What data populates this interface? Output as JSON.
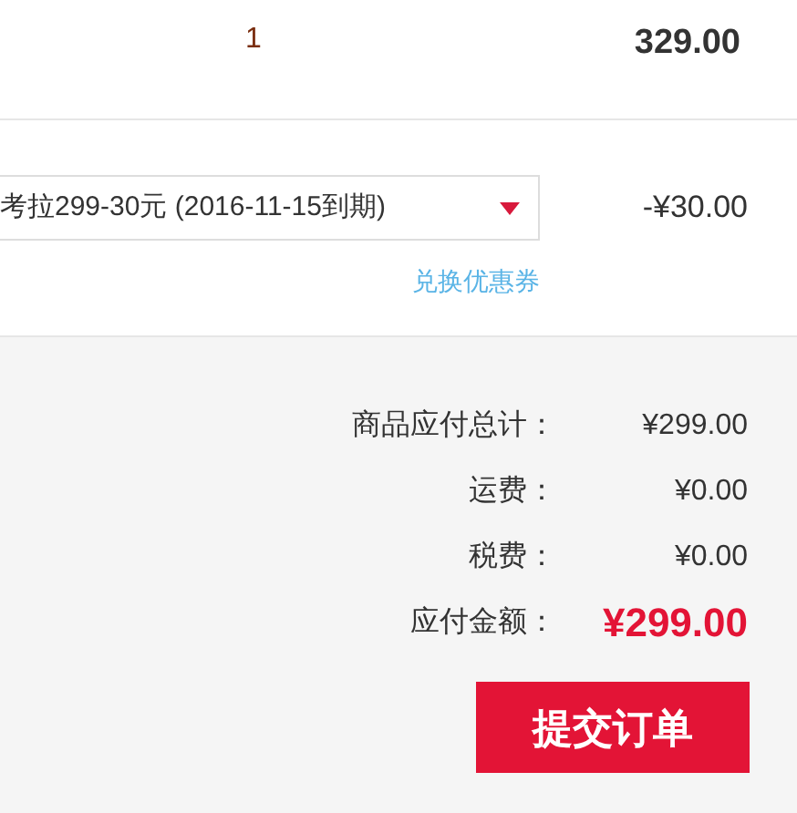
{
  "item": {
    "quantity": "1",
    "subtotal": "329.00"
  },
  "coupon": {
    "value": "考拉299-30元 (2016-11-15到期)",
    "discount": "-¥30.00",
    "redeem_link": "兑换优惠券"
  },
  "summary": [
    {
      "label": "商品应付总计：",
      "value": "¥299.00",
      "kind": "normal"
    },
    {
      "label": "运费：",
      "value": "¥0.00",
      "kind": "normal"
    },
    {
      "label": "税费：",
      "value": "¥0.00",
      "kind": "normal"
    },
    {
      "label": "应付金额：",
      "value": "¥299.00",
      "kind": "total"
    }
  ],
  "submit_button": "提交订单"
}
